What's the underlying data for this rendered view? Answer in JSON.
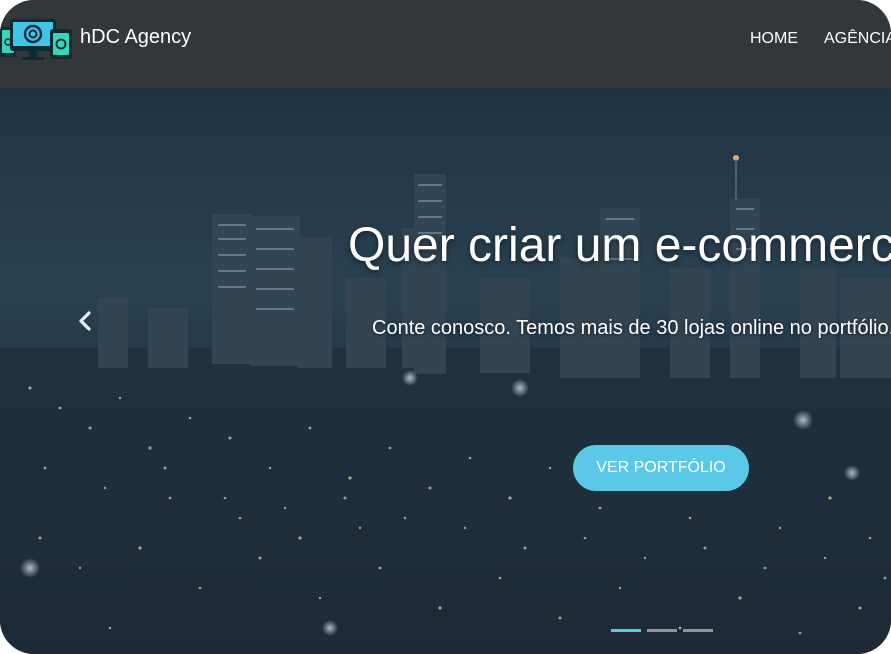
{
  "brand": {
    "name": "hDC Agency",
    "logo_icon": "devices-logo-icon"
  },
  "nav": {
    "items": [
      {
        "label": "HOME"
      },
      {
        "label": "AGÊNCIA"
      }
    ]
  },
  "hero": {
    "title": "Quer criar um e-commerce?",
    "subtitle": "Conte conosco. Temos mais de 30 lojas online no portfólio.",
    "cta_label": "VER PORTFÓLIO",
    "prev_icon": "chevron-left-icon",
    "active_slide": 1,
    "slide_count": 3
  },
  "colors": {
    "navbar": "#33373a",
    "accent": "#5bc8e8",
    "text": "#ffffff"
  }
}
